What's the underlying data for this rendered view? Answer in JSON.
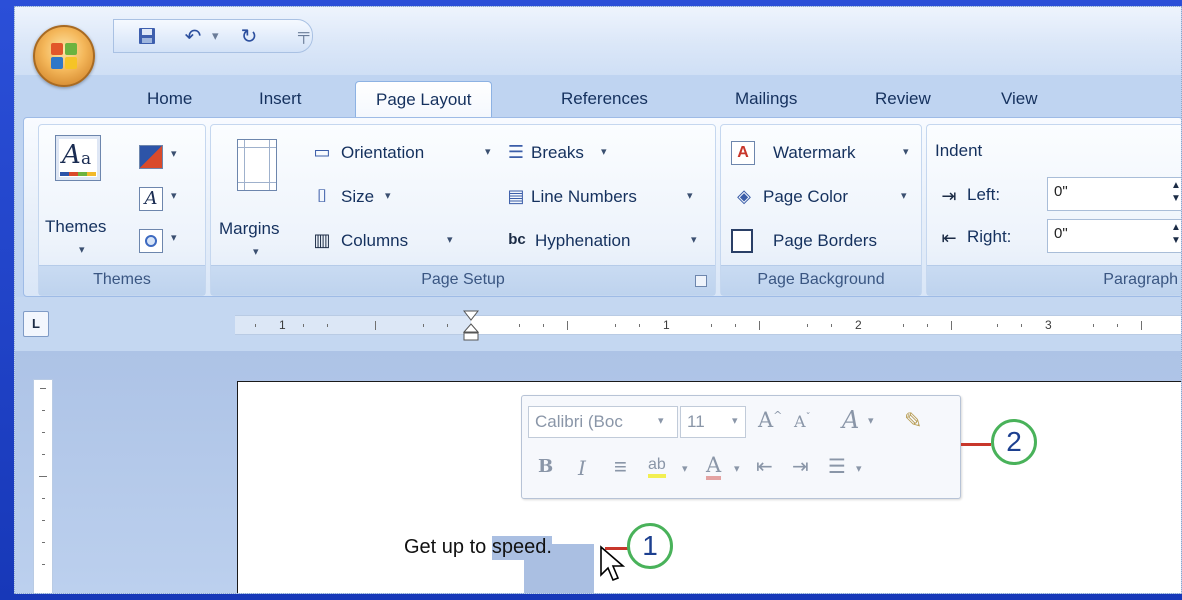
{
  "quick_access": {
    "save_icon": "save-icon",
    "undo_icon": "undo-icon",
    "redo_icon": "redo-icon",
    "customize_icon": "customize-qat-icon"
  },
  "tabs": [
    {
      "label": "Home",
      "active": false
    },
    {
      "label": "Insert",
      "active": false
    },
    {
      "label": "Page Layout",
      "active": true
    },
    {
      "label": "References",
      "active": false
    },
    {
      "label": "Mailings",
      "active": false
    },
    {
      "label": "Review",
      "active": false
    },
    {
      "label": "View",
      "active": false
    }
  ],
  "ribbon": {
    "themes": {
      "themes_label": "Themes",
      "group_label": "Themes"
    },
    "page_setup": {
      "margins_label": "Margins",
      "orientation_label": "Orientation",
      "size_label": "Size",
      "columns_label": "Columns",
      "breaks_label": "Breaks",
      "line_numbers_label": "Line Numbers",
      "hyphenation_label": "Hyphenation",
      "group_label": "Page Setup"
    },
    "page_background": {
      "watermark_label": "Watermark",
      "page_color_label": "Page Color",
      "page_borders_label": "Page Borders",
      "group_label": "Page Background"
    },
    "paragraph": {
      "indent_label": "Indent",
      "left_label": "Left:",
      "left_value": "0\"",
      "right_label": "Right:",
      "right_value": "0\"",
      "group_label": "Paragraph"
    }
  },
  "ruler": {
    "tab_selector": "L",
    "numbers": [
      "1",
      "1",
      "2",
      "3"
    ]
  },
  "document": {
    "text_before": "Get up to ",
    "selected_text": "speed.",
    "text_after": ""
  },
  "mini_toolbar": {
    "font_name": "Calibri (Boc",
    "font_size": "11",
    "grow_font": "A",
    "shrink_font": "A",
    "bold": "B",
    "italic": "I",
    "font_color": "A"
  },
  "callouts": {
    "callout_1": "1",
    "callout_2": "2"
  },
  "colors": {
    "slide_background": "#1a3fc4",
    "callout_line": "#c8372b",
    "callout_ring": "#49b25a",
    "selection": "#aabfe2"
  }
}
